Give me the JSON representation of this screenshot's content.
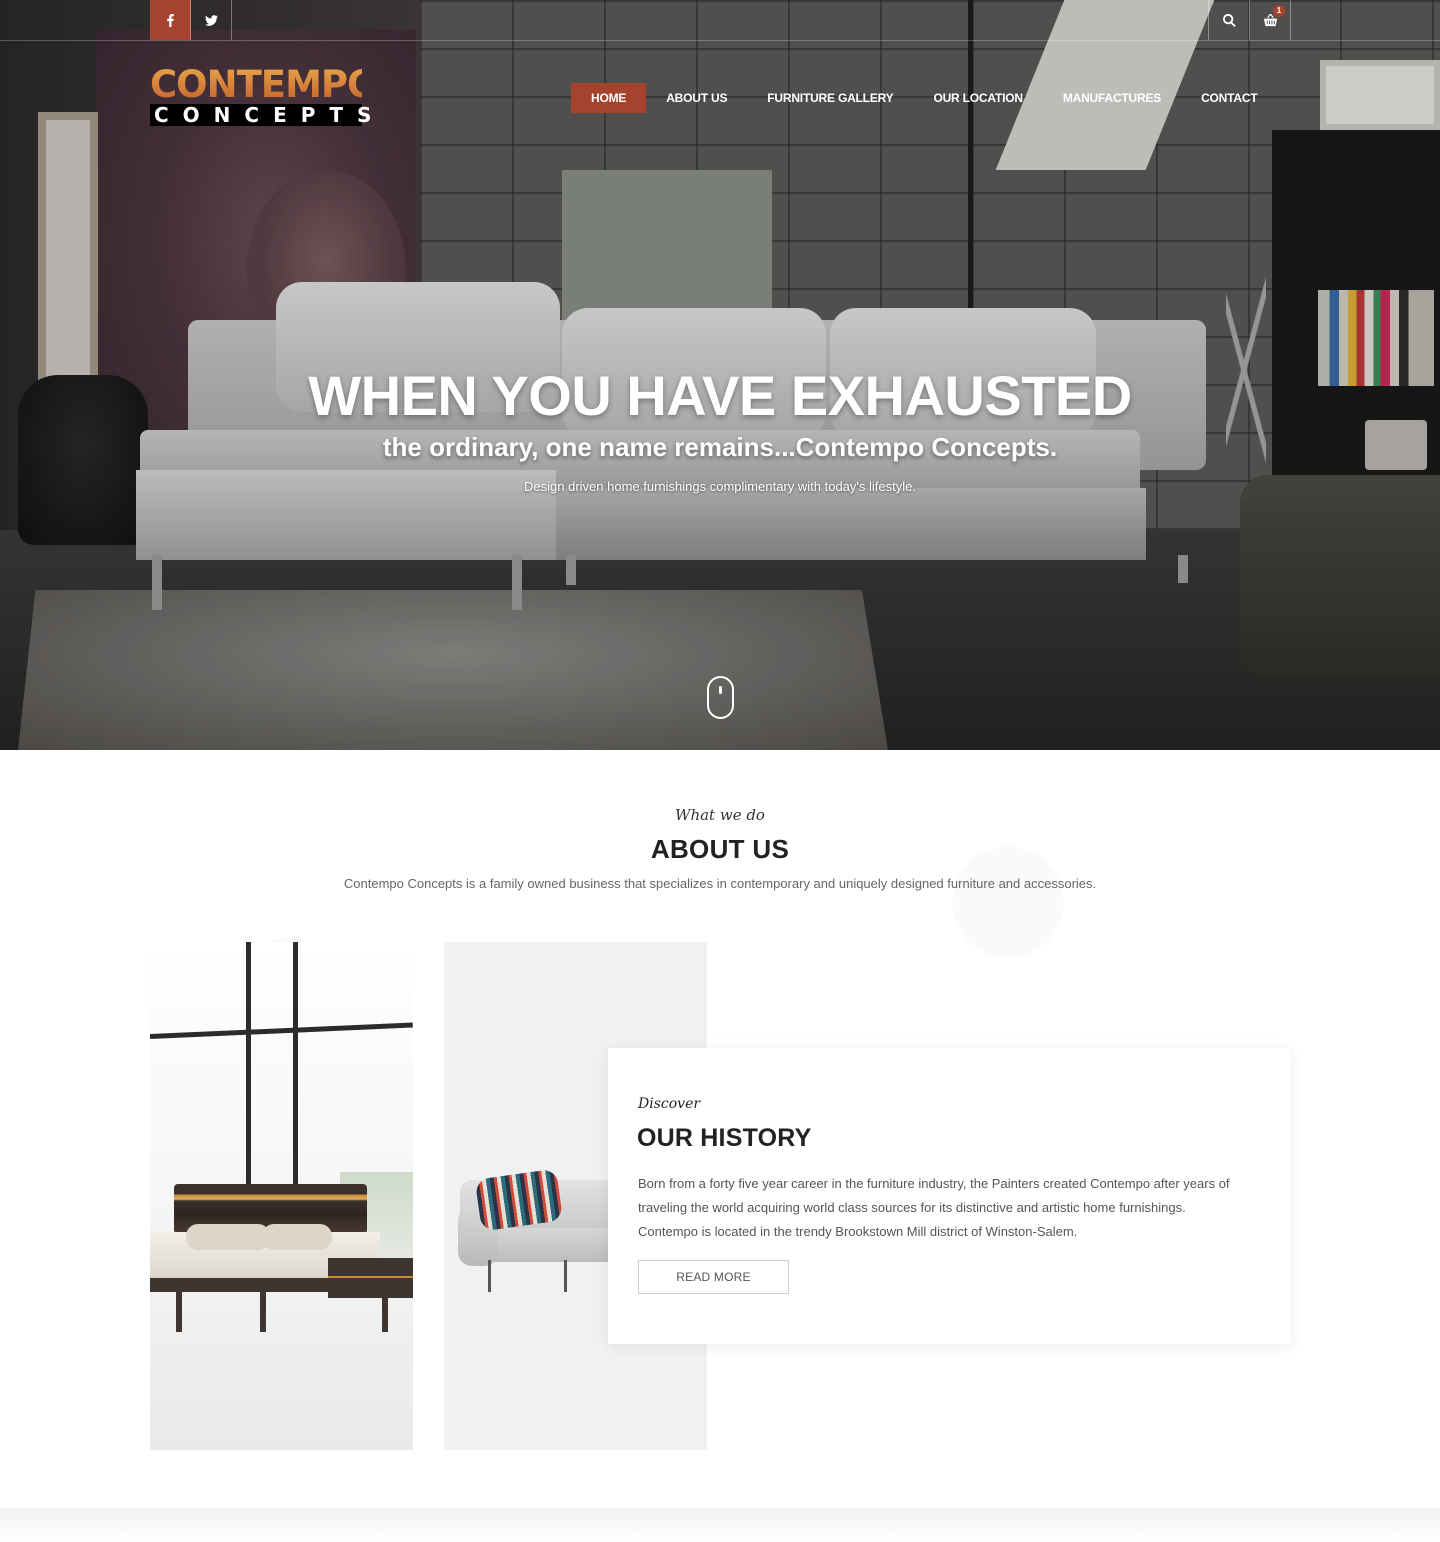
{
  "social": {
    "facebook_icon": "facebook-icon",
    "twitter_icon": "twitter-icon"
  },
  "tools": {
    "search_icon": "search-icon",
    "cart_icon": "basket-icon",
    "cart_count": "1"
  },
  "logo": {
    "top": "CONTEMPO",
    "bottom": "CONCEPTS"
  },
  "nav": {
    "items": [
      {
        "label": "HOME",
        "active": true
      },
      {
        "label": "ABOUT US"
      },
      {
        "label": "FURNITURE GALLERY"
      },
      {
        "label": "OUR LOCATION"
      },
      {
        "label": "MANUFACTURES"
      },
      {
        "label": "CONTACT"
      }
    ]
  },
  "hero": {
    "title": "WHEN YOU HAVE EXHAUSTED",
    "subtitle": "the ordinary, one name remains...Contempo Concepts.",
    "description": "Design driven home furnishings complimentary with today's lifestyle.",
    "scroll_icon": "mouse-scroll-icon"
  },
  "about": {
    "kicker": "What we do",
    "title": "ABOUT US",
    "text": "Contempo Concepts is a family owned business that specializes in contemporary and uniquely designed furniture and accessories."
  },
  "history": {
    "kicker": "Discover",
    "title": "OUR HISTORY",
    "text": "Born from a forty five year career in the furniture industry, the Painters created Contempo after years of traveling the world acquiring world class sources for its distinctive and artistic home furnishings. Contempo is located in the trendy Brookstown Mill district of Winston-Salem.",
    "button": "READ MORE"
  },
  "colors": {
    "accent": "#a6432f",
    "logo_orange": "#d27a35"
  }
}
